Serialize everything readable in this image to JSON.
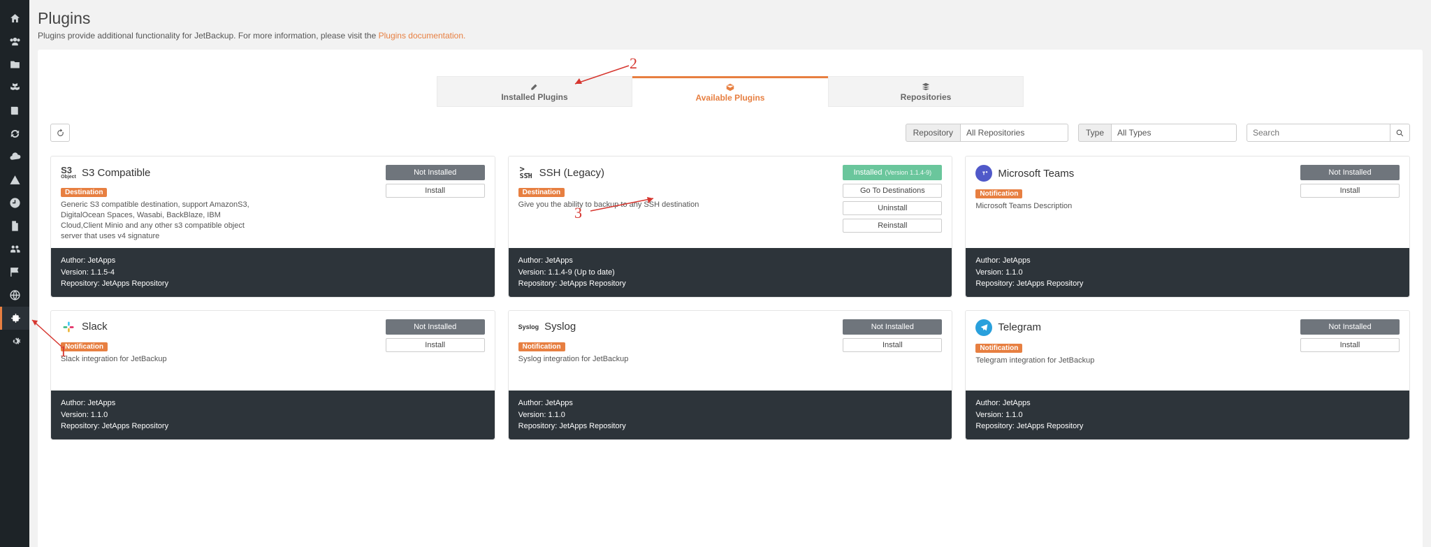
{
  "header": {
    "title": "Plugins",
    "subtitle_pre": "Plugins provide additional functionality for JetBackup. For more information, please visit the ",
    "subtitle_link": "Plugins documentation."
  },
  "tabs": {
    "installed": "Installed Plugins",
    "available": "Available Plugins",
    "repositories": "Repositories"
  },
  "filters": {
    "repo_label": "Repository",
    "repo_value": "All Repositories",
    "type_label": "Type",
    "type_value": "All Types",
    "search_placeholder": "Search"
  },
  "plugins": [
    {
      "id": "s3",
      "title": "S3 Compatible",
      "tag": "Destination",
      "desc": "Generic S3 compatible destination, support AmazonS3, DigitalOcean Spaces, Wasabi, BackBlaze, IBM Cloud,Client Minio and any other s3 compatible object server that uses v4 signature",
      "status_kind": "not",
      "status": "Not Installed",
      "actions": [
        "Install"
      ],
      "author": "Author: JetApps",
      "version": "Version: 1.1.5-4",
      "repo": "Repository: JetApps Repository"
    },
    {
      "id": "ssh",
      "title": "SSH (Legacy)",
      "tag": "Destination",
      "desc": "Give you the ability to backup to any SSH destination",
      "status_kind": "installed",
      "status": "Installed",
      "status_extra": "(Version 1.1.4-9)",
      "actions": [
        "Go To Destinations",
        "Uninstall",
        "Reinstall"
      ],
      "author": "Author: JetApps",
      "version": "Version: 1.1.4-9 (Up to date)",
      "repo": "Repository: JetApps Repository"
    },
    {
      "id": "teams",
      "title": "Microsoft Teams",
      "tag": "Notification",
      "desc": "Microsoft Teams Description",
      "status_kind": "not",
      "status": "Not Installed",
      "actions": [
        "Install"
      ],
      "author": "Author: JetApps",
      "version": "Version: 1.1.0",
      "repo": "Repository: JetApps Repository"
    },
    {
      "id": "slack",
      "title": "Slack",
      "tag": "Notification",
      "desc": "Slack integration for JetBackup",
      "status_kind": "not",
      "status": "Not Installed",
      "actions": [
        "Install"
      ],
      "author": "Author: JetApps",
      "version": "Version: 1.1.0",
      "repo": "Repository: JetApps Repository"
    },
    {
      "id": "syslog",
      "title": "Syslog",
      "tag": "Notification",
      "desc": "Syslog integration for JetBackup",
      "status_kind": "not",
      "status": "Not Installed",
      "actions": [
        "Install"
      ],
      "author": "Author: JetApps",
      "version": "Version: 1.1.0",
      "repo": "Repository: JetApps Repository"
    },
    {
      "id": "telegram",
      "title": "Telegram",
      "tag": "Notification",
      "desc": "Telegram integration for JetBackup",
      "status_kind": "not",
      "status": "Not Installed",
      "actions": [
        "Install"
      ],
      "author": "Author: JetApps",
      "version": "Version: 1.1.0",
      "repo": "Repository: JetApps Repository"
    }
  ],
  "icon_labels": {
    "s3_top": "S3",
    "s3_bot": "Object",
    "ssh_top": ">_",
    "ssh_bot": "SSH",
    "syslog": "Syslog"
  },
  "annotations": {
    "one": "1",
    "two": "2",
    "three": "3"
  }
}
